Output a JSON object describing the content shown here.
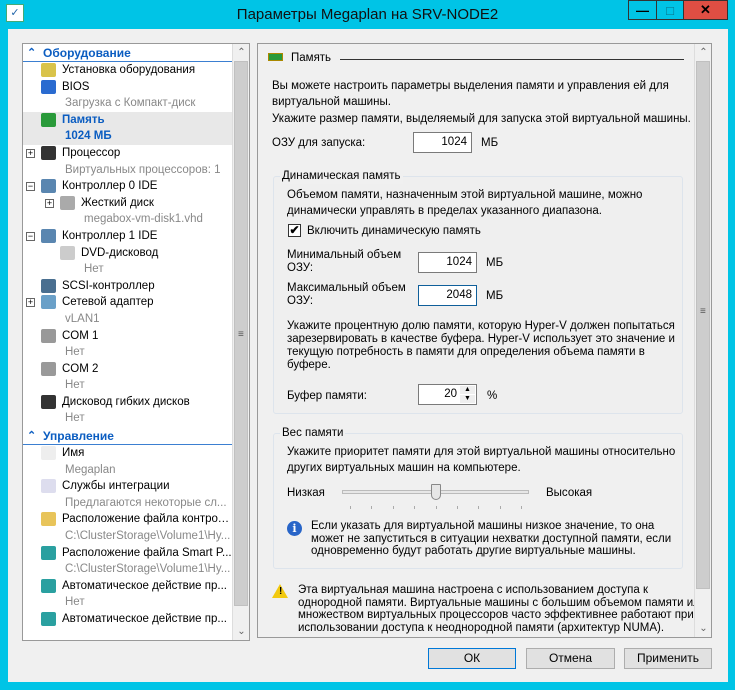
{
  "window": {
    "title": "Параметры Megaplan на SRV-NODE2",
    "minimize": "—",
    "maximize": "□",
    "close": "✕"
  },
  "sidebar": {
    "sections": [
      {
        "label": "Оборудование",
        "items": [
          {
            "title": "Установка оборудования",
            "icon": "add-hardware-icon"
          },
          {
            "title": "BIOS",
            "sub": "Загрузка с Компакт-диск",
            "icon": "bios-icon"
          },
          {
            "title": "Память",
            "sub": "1024 МБ",
            "icon": "memory-icon",
            "selected": true
          },
          {
            "title": "Процессор",
            "sub": "Виртуальных процессоров: 1",
            "icon": "processor-icon",
            "expander": "+"
          },
          {
            "title": "Контроллер 0 IDE",
            "icon": "ide-controller-icon",
            "expander": "−"
          },
          {
            "title": "Жесткий диск",
            "sub": "megabox-vm-disk1.vhd",
            "icon": "hard-disk-icon",
            "expander": "+",
            "level": 2
          },
          {
            "title": "Контроллер 1 IDE",
            "icon": "ide-controller-icon",
            "expander": "−"
          },
          {
            "title": "DVD-дисковод",
            "sub": "Нет",
            "icon": "dvd-icon",
            "level": 2
          },
          {
            "title": "SCSI-контроллер",
            "icon": "scsi-icon"
          },
          {
            "title": "Сетевой адаптер",
            "sub": "vLAN1",
            "icon": "network-adapter-icon",
            "expander": "+"
          },
          {
            "title": "COM 1",
            "sub": "Нет",
            "icon": "com-port-icon"
          },
          {
            "title": "COM 2",
            "sub": "Нет",
            "icon": "com-port-icon"
          },
          {
            "title": "Дисковод гибких дисков",
            "sub": "Нет",
            "icon": "floppy-icon"
          }
        ]
      },
      {
        "label": "Управление",
        "items": [
          {
            "title": "Имя",
            "sub": "Megaplan",
            "icon": "name-icon"
          },
          {
            "title": "Службы интеграции",
            "sub": "Предлагаются некоторые сл...",
            "icon": "integration-services-icon"
          },
          {
            "title": "Расположение файла контрол...",
            "sub": "C:\\ClusterStorage\\Volume1\\Hy...",
            "icon": "checkpoint-folder-icon"
          },
          {
            "title": "Расположение файла Smart P...",
            "sub": "C:\\ClusterStorage\\Volume1\\Hy...",
            "icon": "smart-paging-icon"
          },
          {
            "title": "Автоматическое действие пр...",
            "sub": "Нет",
            "icon": "auto-start-icon"
          },
          {
            "title": "Автоматическое действие пр...",
            "sub": "",
            "icon": "auto-stop-icon"
          }
        ]
      }
    ]
  },
  "memory": {
    "header": "Память",
    "intro": "Вы можете настроить параметры выделения памяти и управления ей для\nвиртуальной машины.",
    "startup_hint": "Укажите размер памяти, выделяемый для запуска этой виртуальной машины.",
    "startup_label": "ОЗУ для запуска:",
    "startup_value": "1024",
    "unit": "МБ",
    "dynamic": {
      "caption": "Динамическая память",
      "desc": "Объемом памяти, назначенным этой виртуальной машине, можно\nдинамически управлять в пределах указанного диапазона.",
      "enable_label": "Включить динамическую память",
      "enabled": true,
      "min_label": "Минимальный объем\nОЗУ:",
      "min_value": "1024",
      "max_label": "Максимальный объем\nОЗУ:",
      "max_value": "2048",
      "buffer_desc": "Укажите процентную долю памяти, которую Hyper-V должен попытаться\nзарезервировать в качестве буфера. Hyper-V использует это значение и\nтекущую потребность в памяти для определения объема памяти в\nбуфере.",
      "buffer_label": "Буфер памяти:",
      "buffer_value": "20",
      "buffer_unit": "%"
    },
    "weight": {
      "caption": "Вес памяти",
      "desc": "Укажите приоритет памяти для этой виртуальной машины относительно\nдругих виртуальных машин на компьютере.",
      "low": "Низкая",
      "high": "Высокая",
      "value_fraction": 0.5,
      "info": "Если указать для виртуальной машины низкое значение, то она\nможет не запуститься в ситуации нехватки доступной памяти, если\nодновременно будут работать другие виртуальные машины."
    },
    "warning": "Эта виртуальная машина настроена с использованием доступа к\nоднородной памяти. Виртуальные машины с большим объемом памяти или\nмножеством виртуальных процессоров часто эффективнее работают при\nиспользовании доступа к неоднородной памяти (архитектур NUMA)."
  },
  "buttons": {
    "ok": "ОК",
    "cancel": "Отмена",
    "apply": "Применить"
  }
}
